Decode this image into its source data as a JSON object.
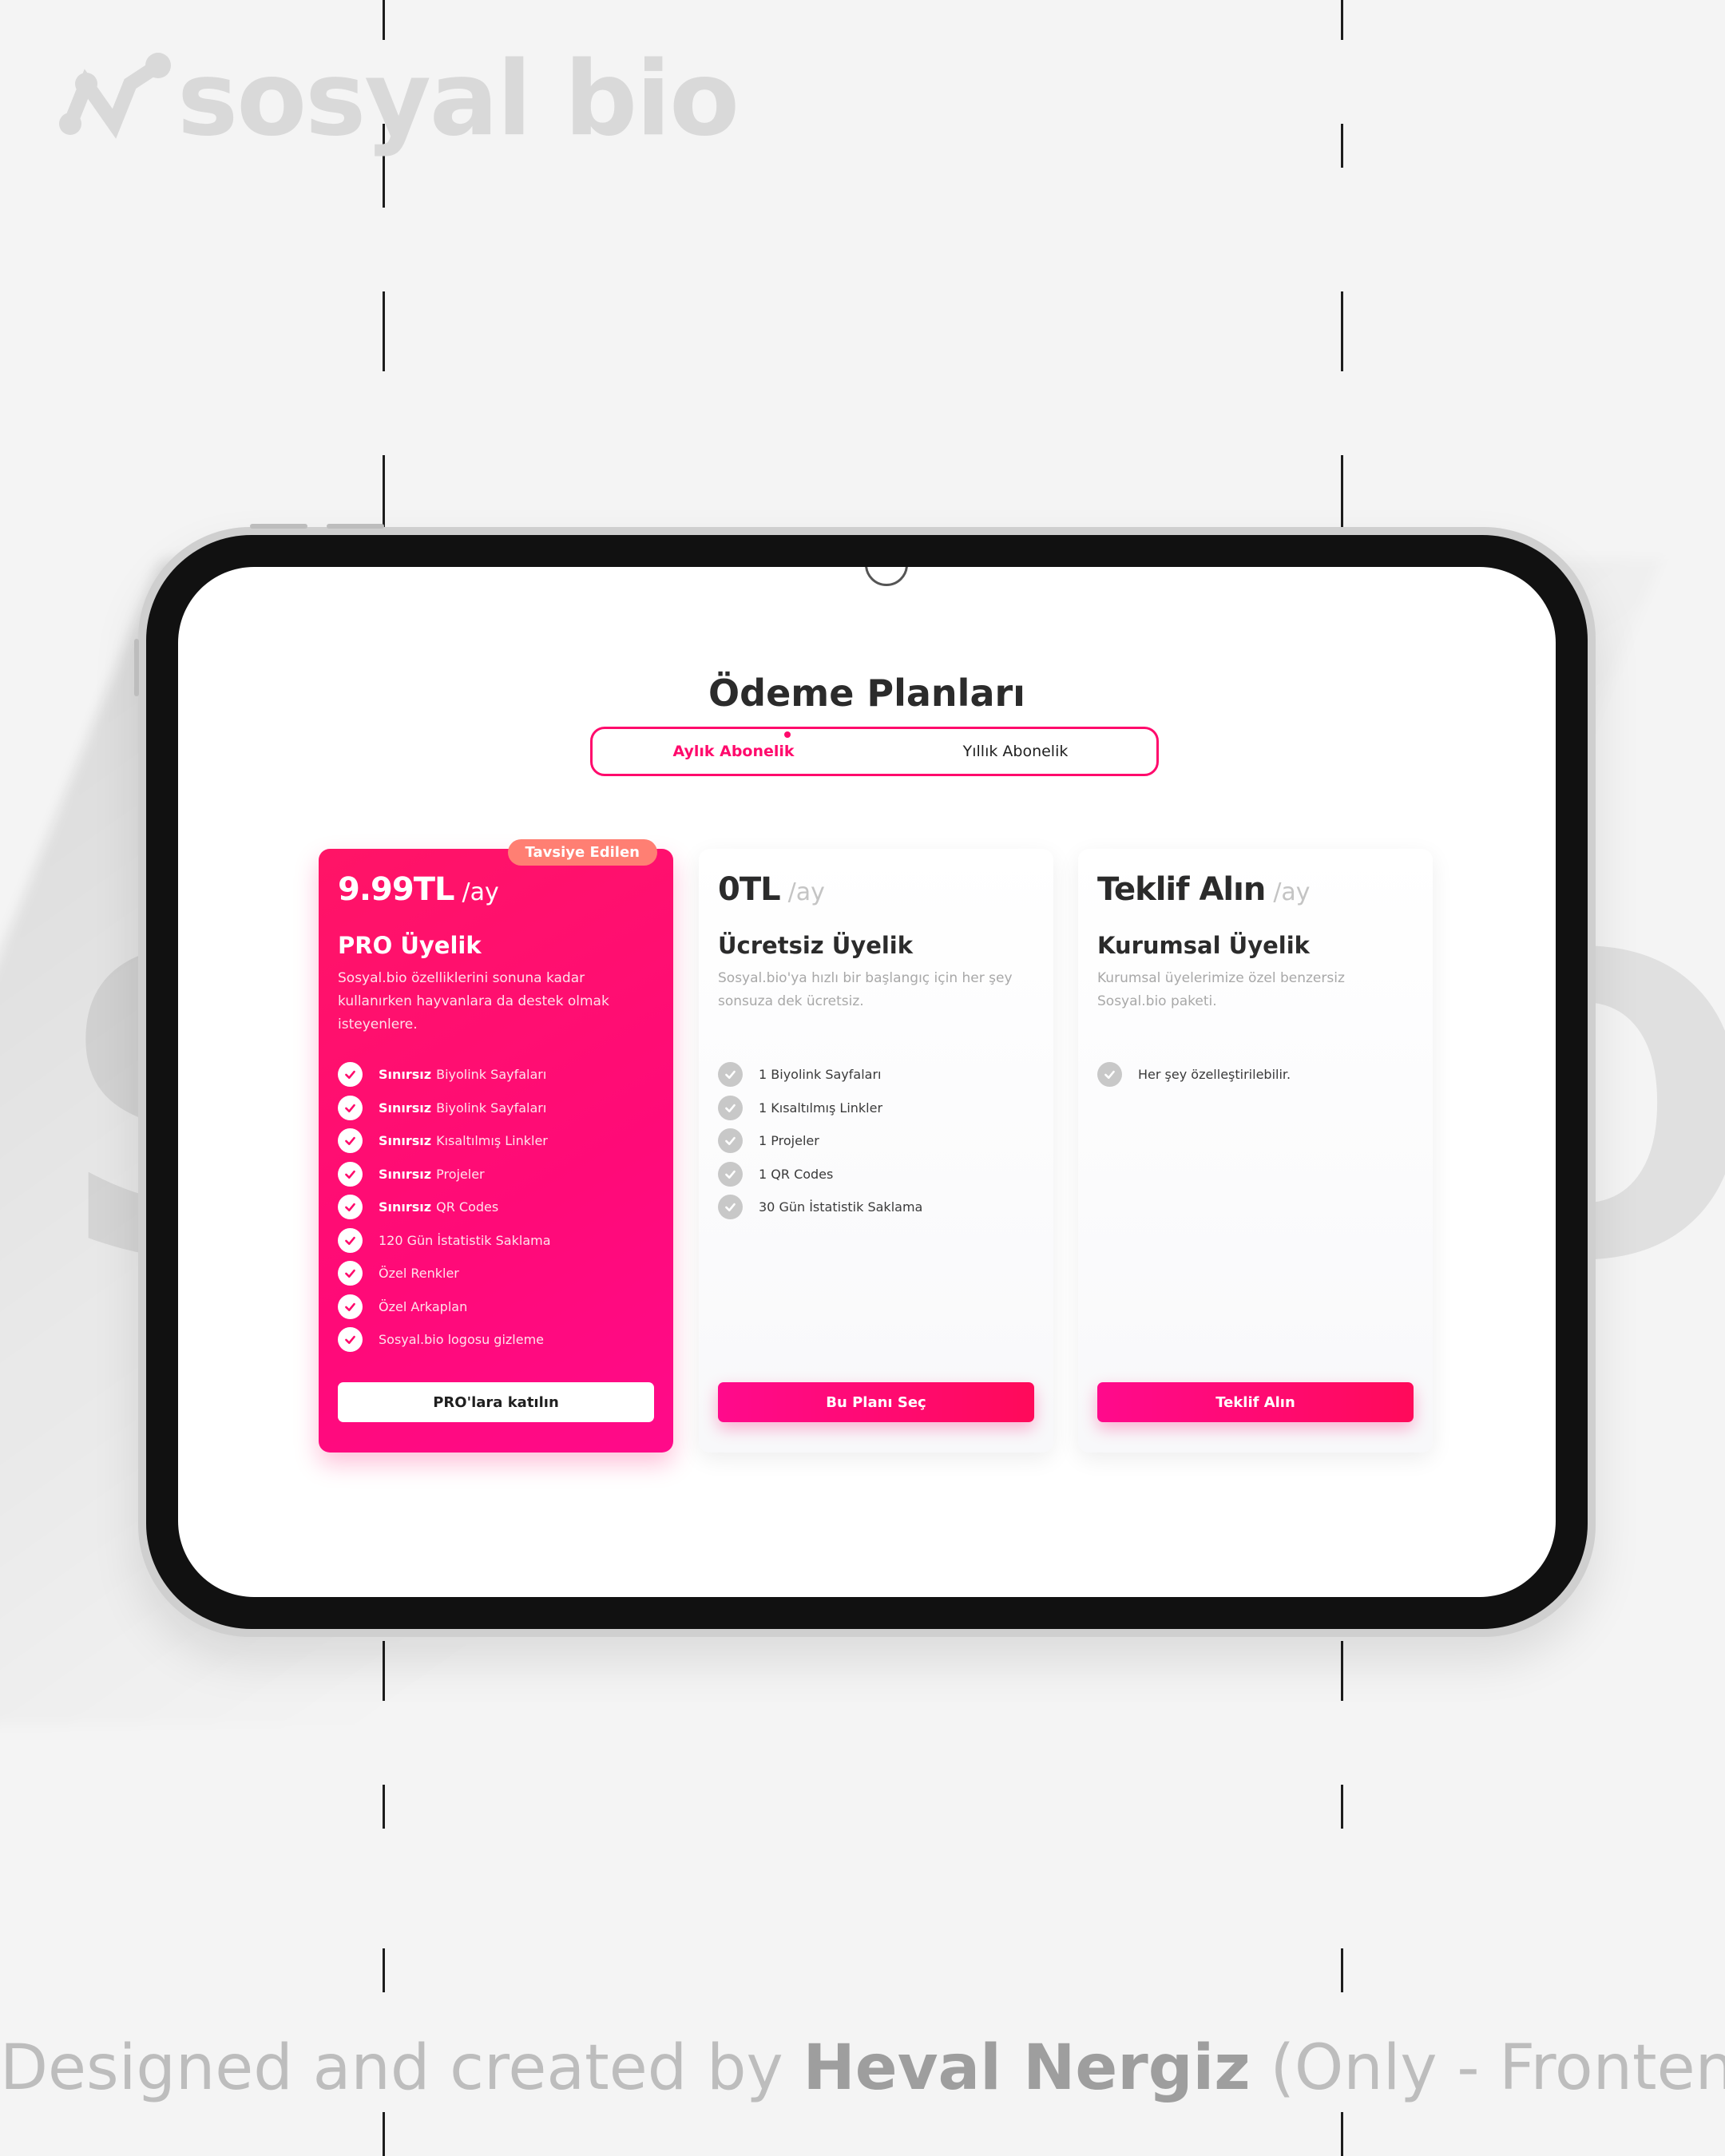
{
  "brand": {
    "logo_text": "sosyal bio",
    "accent": "#ff0a6c"
  },
  "background": {
    "letter_left": "S",
    "letter_right": "O"
  },
  "page": {
    "title": "Ödeme Planları"
  },
  "billing_toggle": {
    "monthly": "Aylık Abonelik",
    "yearly": "Yıllık Abonelik",
    "selected": "monthly"
  },
  "plans": [
    {
      "badge": "Tavsiye Edilen",
      "price": "9.99TL",
      "period": "/ay",
      "name": "PRO Üyelik",
      "description": "Sosyal.bio özelliklerini sonuna kadar kullanırken hayvanlara da destek olmak isteyenlere.",
      "features": [
        {
          "strong": "Sınırsız",
          "text": "Biyolink Sayfaları"
        },
        {
          "strong": "Sınırsız",
          "text": "Biyolink Sayfaları"
        },
        {
          "strong": "Sınırsız",
          "text": "Kısaltılmış Linkler"
        },
        {
          "strong": "Sınırsız",
          "text": "Projeler"
        },
        {
          "strong": "Sınırsız",
          "text": "QR Codes"
        },
        {
          "strong": "",
          "text": "120 Gün İstatistik Saklama"
        },
        {
          "strong": "",
          "text": "Özel Renkler"
        },
        {
          "strong": "",
          "text": "Özel Arkaplan"
        },
        {
          "strong": "",
          "text": "Sosyal.bio logosu gizleme"
        }
      ],
      "cta": "PRO'lara katılın"
    },
    {
      "price": "0TL",
      "period": "/ay",
      "name": "Ücretsiz Üyelik",
      "description": "Sosyal.bio'ya hızlı bir başlangıç için her şey sonsuza dek ücretsiz.",
      "features": [
        {
          "text": "1 Biyolink Sayfaları"
        },
        {
          "text": "1 Kısaltılmış Linkler"
        },
        {
          "text": "1 Projeler"
        },
        {
          "text": "1 QR Codes"
        },
        {
          "text": "30 Gün İstatistik Saklama"
        }
      ],
      "cta": "Bu Planı Seç"
    },
    {
      "price": "Teklif Alın",
      "period": "/ay",
      "name": "Kurumsal Üyelik",
      "description": "Kurumsal üyelerimize özel benzersiz Sosyal.bio paketi.",
      "features": [
        {
          "text": "Her şey özelleştirilebilir."
        }
      ],
      "cta": "Teklif Alın"
    }
  ],
  "credit": {
    "prefix": "Designed and created by",
    "author": "Heval Nergiz",
    "suffix": "(Only - Frontend)"
  }
}
